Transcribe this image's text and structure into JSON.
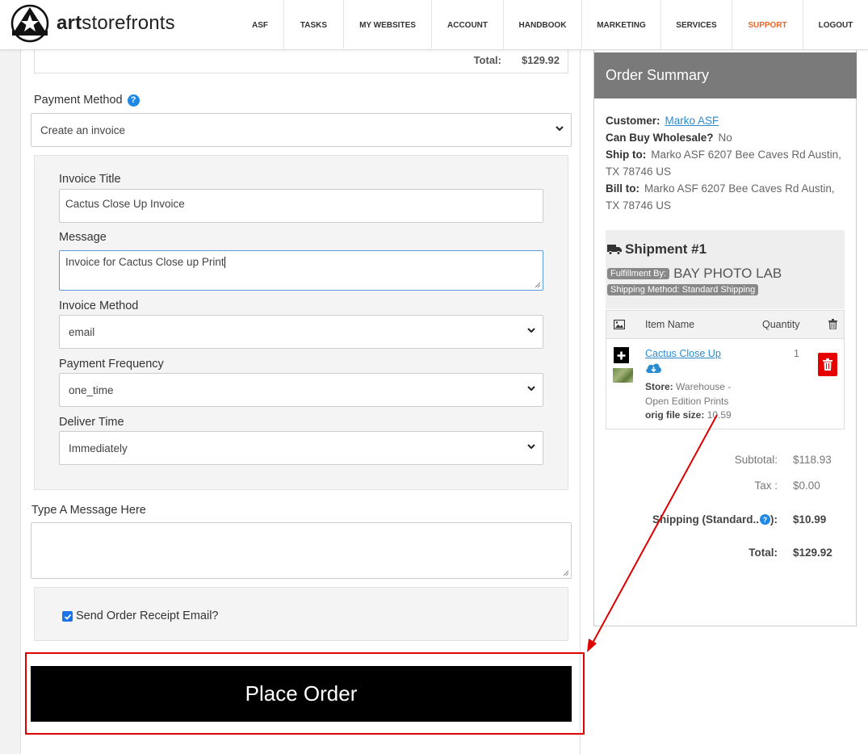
{
  "header": {
    "logo_bold": "art",
    "logo_rest": "storefronts",
    "nav": [
      "ASF",
      "TASKS",
      "MY WEBSITES",
      "ACCOUNT",
      "HANDBOOK",
      "MARKETING",
      "SERVICES",
      "SUPPORT",
      "LOGOUT"
    ]
  },
  "order": {
    "total_label": "Total:",
    "total_value": "$129.92"
  },
  "payment": {
    "label": "Payment Method",
    "help": "?",
    "selected": "Create an invoice"
  },
  "invoice": {
    "title_label": "Invoice Title",
    "title_value": "Cactus Close Up Invoice",
    "message_label": "Message",
    "message_value": "Invoice for Cactus Close up Print",
    "method_label": "Invoice Method",
    "method_value": "email",
    "frequency_label": "Payment Frequency",
    "frequency_value": "one_time",
    "deliver_label": "Deliver Time",
    "deliver_value": "Immediately"
  },
  "message_box": {
    "label": "Type A Message Here",
    "value": ""
  },
  "receipt": {
    "label": "Send Order Receipt Email?",
    "checked": true
  },
  "place_order": {
    "label": "Place Order"
  },
  "summary": {
    "title": "Order Summary",
    "customer_label": "Customer:",
    "customer_value": "Marko ASF",
    "wholesale_label": "Can Buy Wholesale?",
    "wholesale_value": "No",
    "ship_to_label": "Ship to:",
    "ship_to_value": "Marko ASF 6207 Bee Caves Rd Austin, TX 78746 US",
    "bill_to_label": "Bill to:",
    "bill_to_value": "Marko ASF 6207 Bee Caves Rd Austin, TX 78746 US",
    "shipment_title": "Shipment #1",
    "fulfillment_label": "Fulfillment By:",
    "fulfillment_value": "BAY PHOTO LAB",
    "shipping_method": "Shipping Method: Standard Shipping",
    "col_item": "Item Name",
    "col_qty": "Quantity",
    "item_name": "Cactus Close Up",
    "item_qty": "1",
    "store_label": "Store:",
    "store_value": "Warehouse - Open Edition Prints",
    "filesize_label": "orig file size:",
    "filesize_value": "10.59",
    "subtotal_label": "Subtotal:",
    "subtotal_value": "$118.93",
    "tax_label": "Tax :",
    "tax_value": "$0.00",
    "shipping_label": "Shipping (Standard..",
    "shipping_value": "$10.99",
    "total_label": "Total:",
    "total_value": "$129.92"
  },
  "colors": {
    "accent_blue": "#1e88e5",
    "support_orange": "#e8662b",
    "highlight_red": "#e00000",
    "summary_header": "#7a7a7a"
  }
}
